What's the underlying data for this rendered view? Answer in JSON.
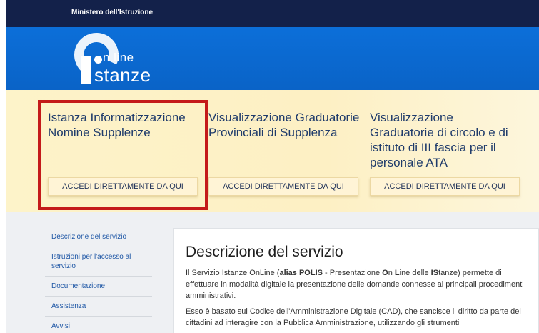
{
  "topbar": {
    "ministry": "Ministero dell'Istruzione"
  },
  "logo": {
    "line1": "n line",
    "line2": "stanze"
  },
  "cards": [
    {
      "title": "Istanza Informatizzazione Nomine Supplenze",
      "button": "ACCEDI DIRETTAMENTE DA QUI"
    },
    {
      "title": "Visualizzazione Graduatorie Provinciali di Supplenza",
      "button": "ACCEDI DIRETTAMENTE DA QUI"
    },
    {
      "title": "Visualizzazione Graduatorie di circolo e di istituto di III fascia per il personale ATA",
      "button": "ACCEDI DIRETTAMENTE DA QUI"
    }
  ],
  "sidenav": {
    "items": [
      "Descrizione del servizio",
      "Istruzioni per l'accesso al servizio",
      "Documentazione",
      "Assistenza",
      "Avvisi"
    ]
  },
  "content": {
    "title": "Descrizione del servizio",
    "p1_a": "Il Servizio Istanze OnLine (",
    "p1_b": "alias POLIS",
    "p1_c": " - Presentazione ",
    "p1_d": "O",
    "p1_e": "n ",
    "p1_f": "L",
    "p1_g": "ine delle ",
    "p1_h": "IS",
    "p1_i": "tanze) permette di effettuare in modalità digitale la presentazione delle domande connesse ai principali procedimenti amministrativi.",
    "p2": "Esso è basato sul Codice dell'Amministrazione Digitale (CAD), che sancisce il diritto da parte dei cittadini ad interagire con la Pubblica Amministrazione, utilizzando gli strumenti"
  },
  "colors": {
    "topbar": "#13214a",
    "header": "#0a6ad4",
    "highlight": "#c41a1a"
  }
}
